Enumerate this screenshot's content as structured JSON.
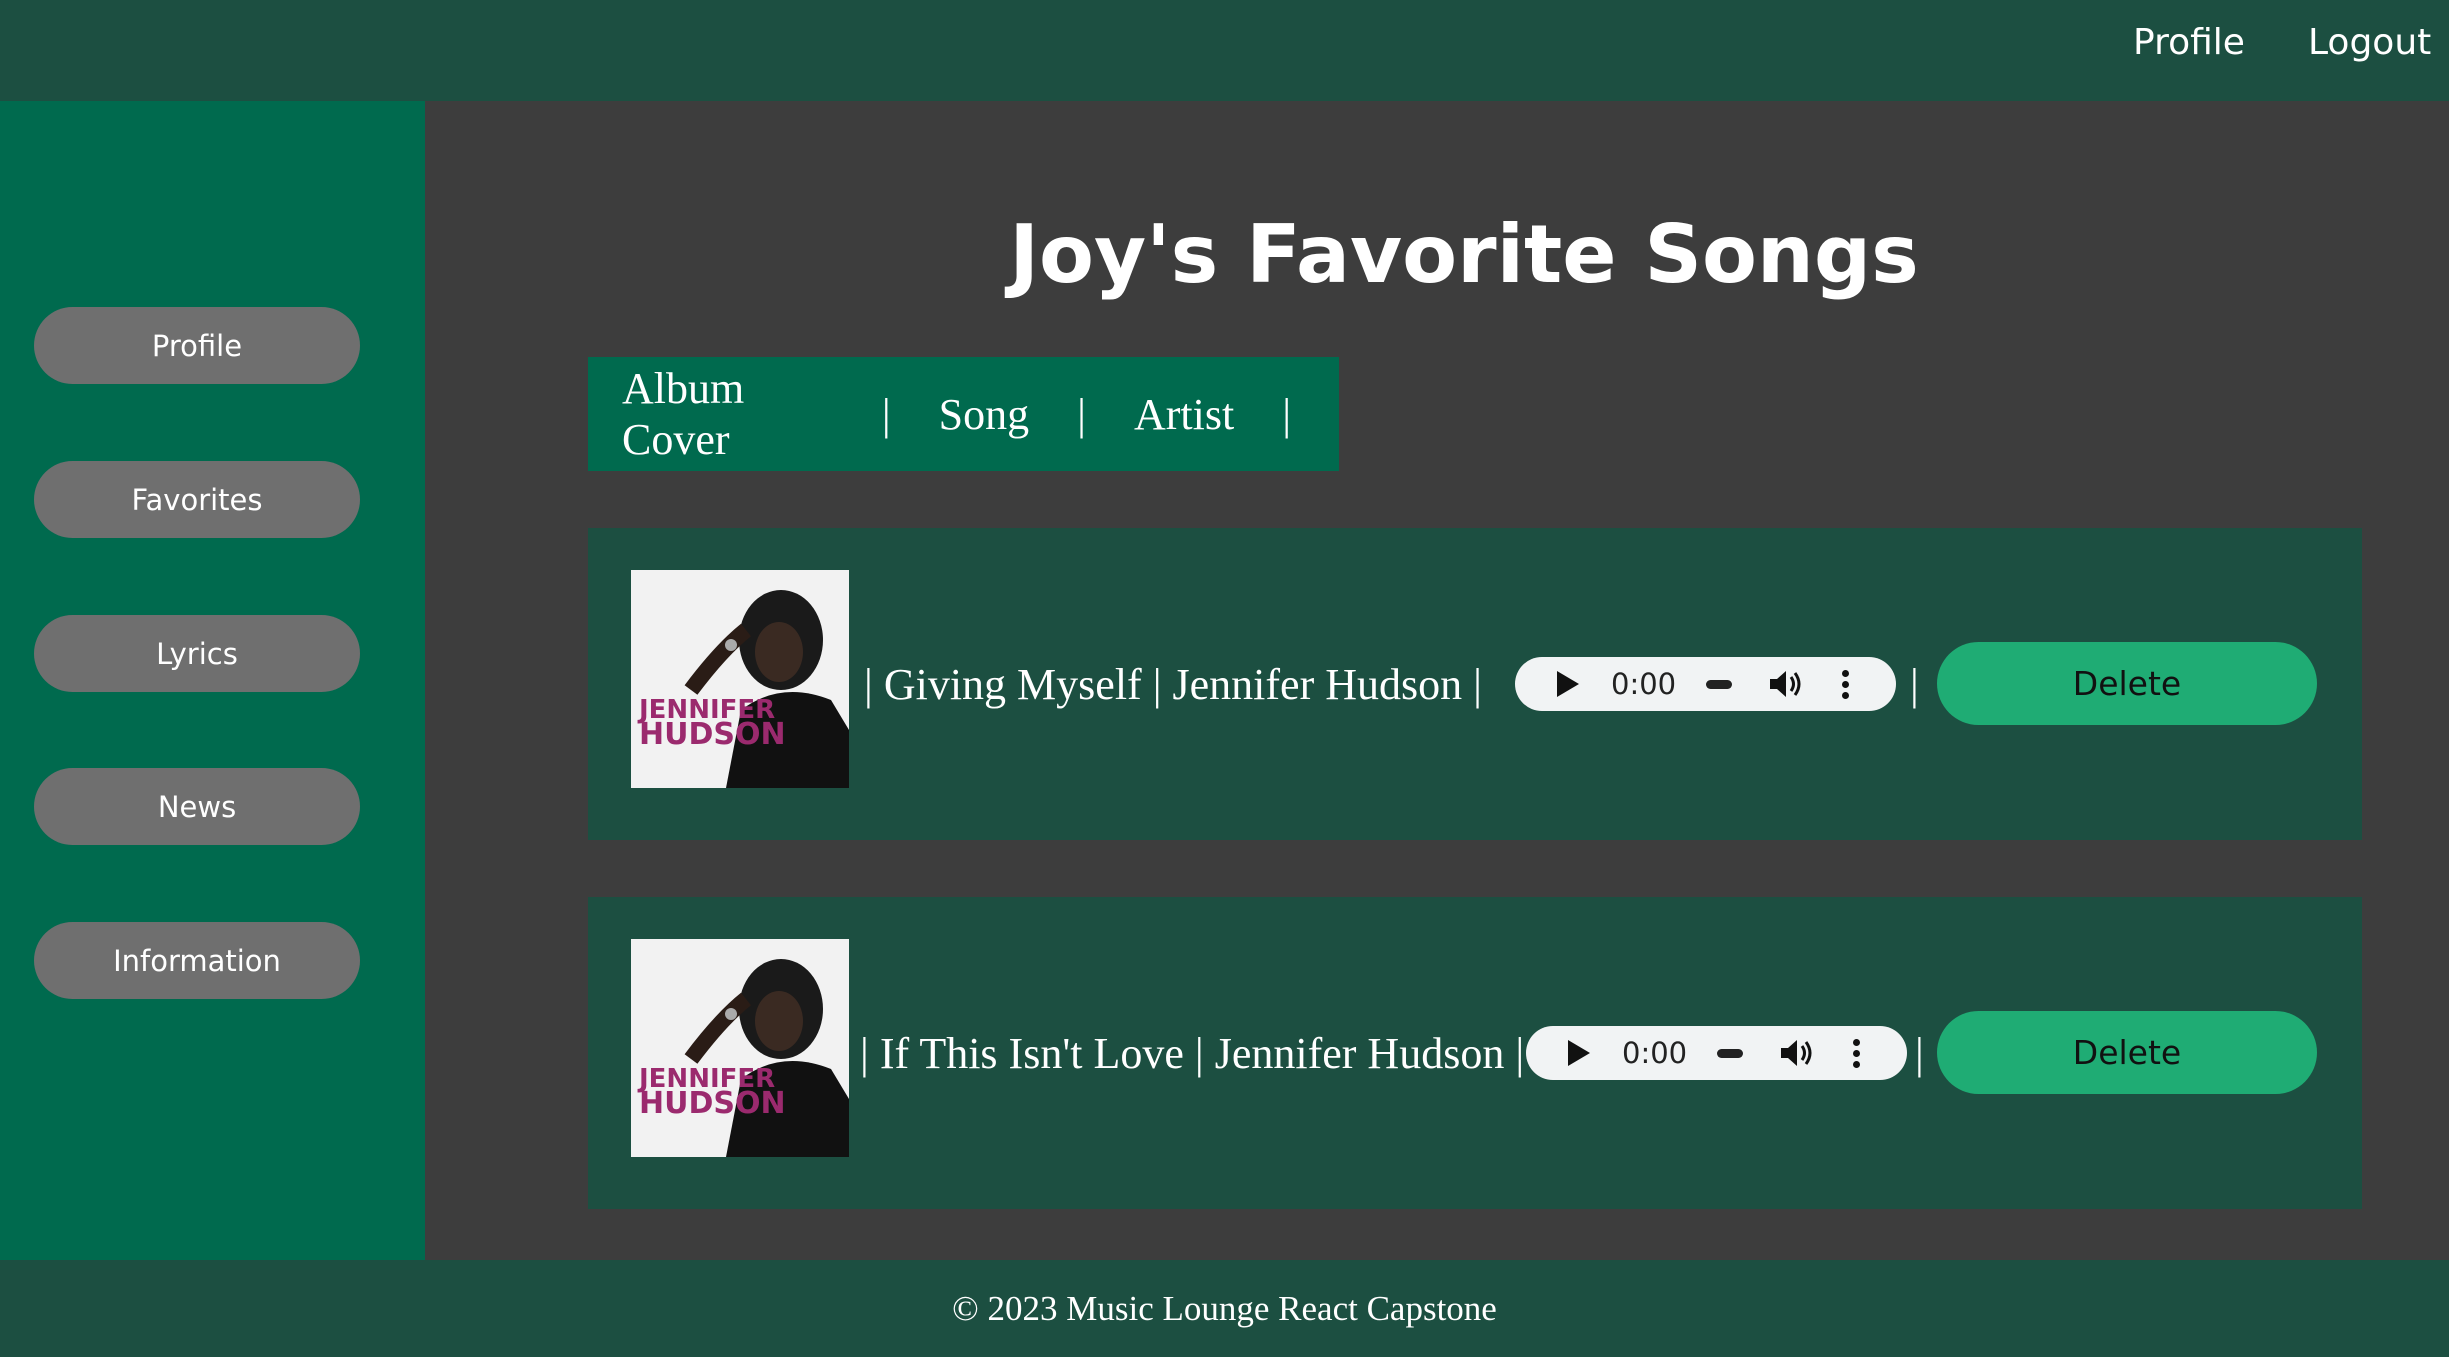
{
  "topnav": {
    "profile": "Profile",
    "logout": "Logout"
  },
  "sidebar": {
    "items": [
      {
        "label": "Profile"
      },
      {
        "label": "Favorites"
      },
      {
        "label": "Lyrics"
      },
      {
        "label": "News"
      },
      {
        "label": "Information"
      }
    ]
  },
  "page": {
    "title": "Joy's Favorite Songs"
  },
  "table_header": {
    "col1": "Album Cover",
    "col2": "Song",
    "col3": "Artist",
    "sep": "|"
  },
  "songs": [
    {
      "pre": "|",
      "song": "Giving Myself",
      "mid": "|",
      "artist": "Jennifer Hudson",
      "post": "|",
      "time": "0:00",
      "after_audio": "|",
      "delete": "Delete",
      "cover_text_1": "JENNIFER",
      "cover_text_2": "HUDSON"
    },
    {
      "pre": "|",
      "song": "If This Isn't Love",
      "mid": "|",
      "artist": "Jennifer Hudson",
      "post": "|",
      "time": "0:00",
      "after_audio": "|",
      "delete": "Delete",
      "cover_text_1": "JENNIFER",
      "cover_text_2": "HUDSON"
    }
  ],
  "footer": {
    "text": "© 2023 Music Lounge React Capstone"
  },
  "colors": {
    "topbar": "#1c4f41",
    "sidebar": "#006a4e",
    "content_bg": "#3d3d3d",
    "button_gray": "#6f6f6f",
    "delete_green": "#1fac74"
  }
}
